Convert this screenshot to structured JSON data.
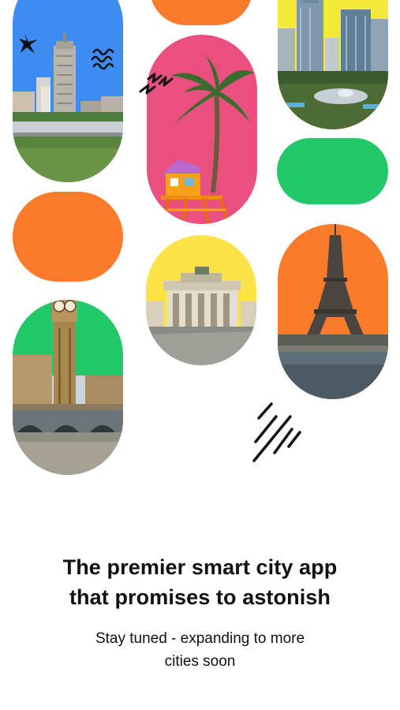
{
  "screen": {
    "headline_line1": "The premier smart city app",
    "headline_line2": "that promises to astonish",
    "subtitle_line1": "Stay tuned - expanding to more",
    "subtitle_line2": "cities soon"
  },
  "palette": {
    "orange": "#fb7b2c",
    "pink": "#e9507f",
    "green": "#23c86a",
    "yellow": "#fde34a",
    "blue": "#3e8cf2",
    "text": "#111111"
  },
  "cards": [
    {
      "icon": "boston-skyline-photo"
    },
    {
      "icon": "miami-lifeguard-tower-photo"
    },
    {
      "icon": "chicago-skyline-photo"
    },
    {
      "icon": "london-big-ben-photo"
    },
    {
      "icon": "berlin-brandenburg-gate-photo"
    },
    {
      "icon": "paris-eiffel-tower-photo"
    }
  ]
}
